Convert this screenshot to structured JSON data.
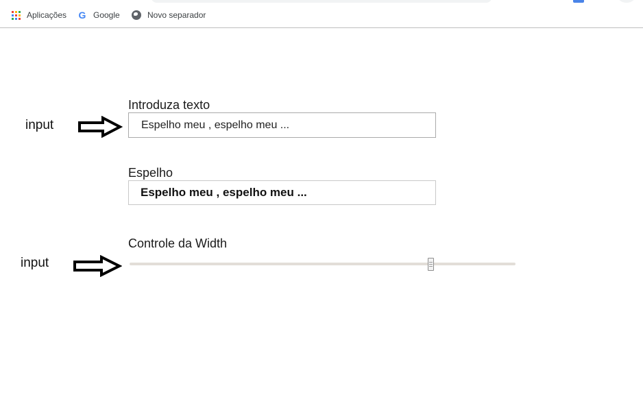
{
  "bookmarks_bar": {
    "items": [
      {
        "label": "Aplicações",
        "icon": "apps-grid-icon"
      },
      {
        "label": "Google",
        "icon": "google-g-icon"
      },
      {
        "label": "Novo separador",
        "icon": "globe-icon"
      }
    ]
  },
  "form": {
    "text_input": {
      "label": "Introduza texto",
      "value": "Espelho meu , espelho meu ..."
    },
    "mirror": {
      "label": "Espelho",
      "value": "Espelho meu , espelho meu ..."
    },
    "width_control": {
      "label": "Controle da Width",
      "value_fraction": 0.78
    }
  },
  "annotations": {
    "first": "input",
    "second": "input"
  },
  "colors": {
    "apps_grid": [
      "#ea4335",
      "#fbbc05",
      "#34a853",
      "#4285f4",
      "#ea4335",
      "#fbbc05",
      "#34a853",
      "#4285f4",
      "#ea4335"
    ],
    "google_g": "#4285f4",
    "slider_track": "#e2ded8"
  }
}
